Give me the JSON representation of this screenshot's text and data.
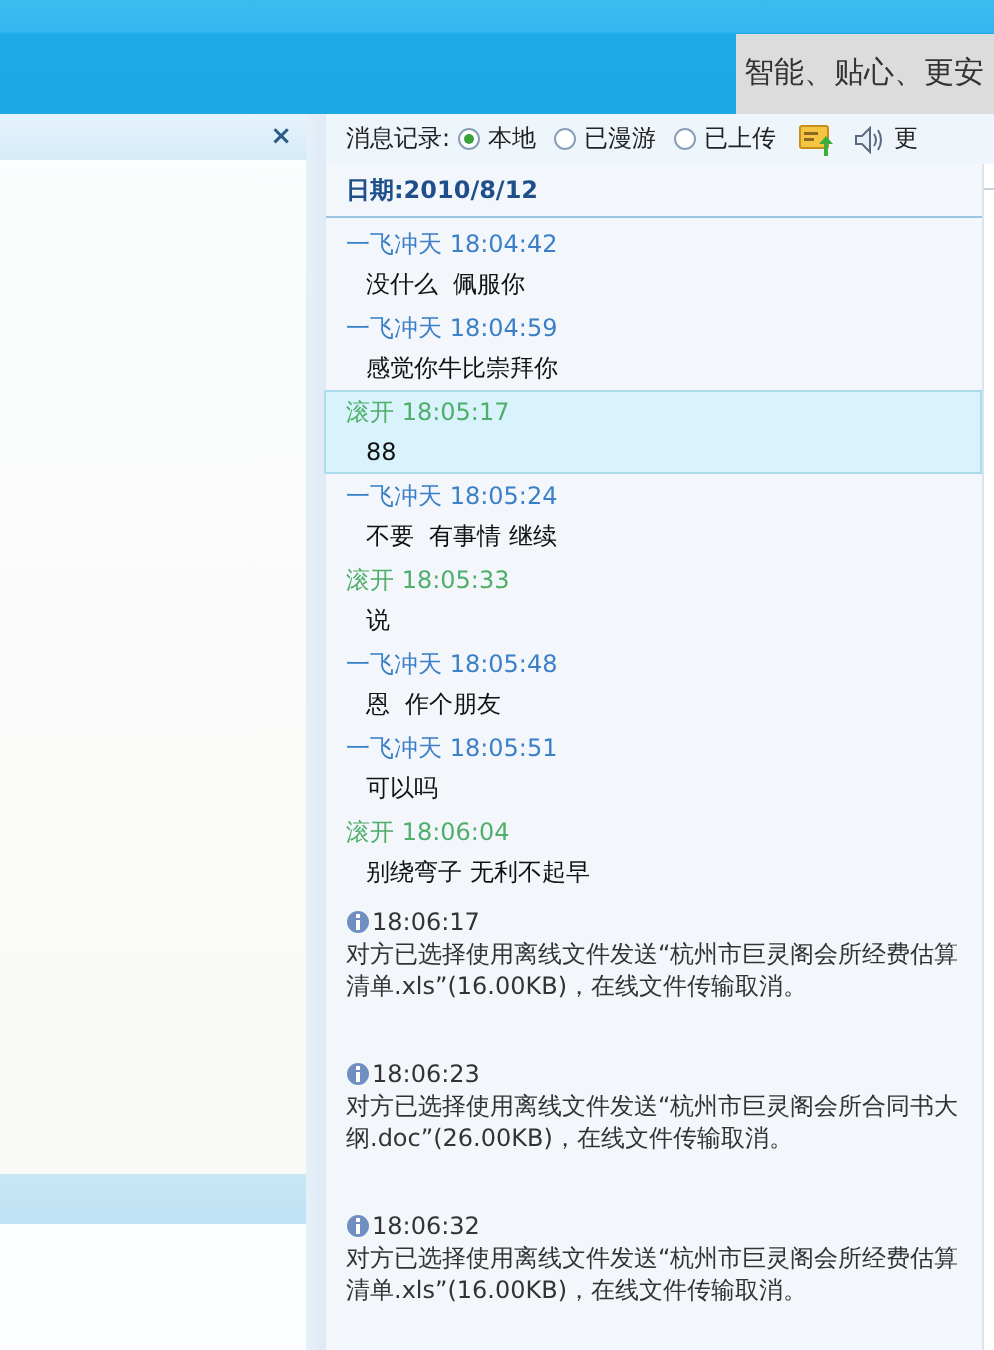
{
  "banner": {
    "slogan": "智能、贴心、更安"
  },
  "left_panel": {
    "close": "×"
  },
  "toolbar": {
    "label": "消息记录:",
    "options": [
      {
        "label": "本地",
        "selected": true
      },
      {
        "label": "已漫游",
        "selected": false
      },
      {
        "label": "已上传",
        "selected": false
      }
    ],
    "more": "更"
  },
  "date_header": {
    "label": "日期:",
    "value": "2010/8/12"
  },
  "messages": [
    {
      "kind": "chat",
      "sender": "一飞冲天",
      "time": "18:04:42",
      "text": "没什么  佩服你",
      "color": "#3a7fc8",
      "selected": false
    },
    {
      "kind": "chat",
      "sender": "一飞冲天",
      "time": "18:04:59",
      "text": "感觉你牛比崇拜你",
      "color": "#3a7fc8",
      "selected": false
    },
    {
      "kind": "chat",
      "sender": "滚开",
      "time": "18:05:17",
      "text": "88",
      "color": "#4fae6a",
      "selected": true
    },
    {
      "kind": "chat",
      "sender": "一飞冲天",
      "time": "18:05:24",
      "text": "不要  有事情 继续",
      "color": "#3a7fc8",
      "selected": false
    },
    {
      "kind": "chat",
      "sender": "滚开",
      "time": "18:05:33",
      "text": "说",
      "color": "#4fae6a",
      "selected": false
    },
    {
      "kind": "chat",
      "sender": "一飞冲天",
      "time": "18:05:48",
      "text": "恩  作个朋友",
      "color": "#3a7fc8",
      "selected": false
    },
    {
      "kind": "chat",
      "sender": "一飞冲天",
      "time": "18:05:51",
      "text": "可以吗",
      "color": "#3a7fc8",
      "selected": false
    },
    {
      "kind": "chat",
      "sender": "滚开",
      "time": "18:06:04",
      "text": "别绕弯子 无利不起早",
      "color": "#4fae6a",
      "selected": false
    },
    {
      "kind": "system",
      "time": "18:06:17",
      "text": "对方已选择使用离线文件发送“杭州市巨灵阁会所经费估算清单.xls”(16.00KB)，在线文件传输取消。"
    },
    {
      "kind": "system",
      "time": "18:06:23",
      "text": "对方已选择使用离线文件发送“杭州市巨灵阁会所合同书大纲.doc”(26.00KB)，在线文件传输取消。"
    },
    {
      "kind": "system",
      "time": "18:06:32",
      "text": "对方已选择使用离线文件发送“杭州市巨灵阁会所经费估算清单.xls”(16.00KB)，在线文件传输取消。"
    }
  ]
}
